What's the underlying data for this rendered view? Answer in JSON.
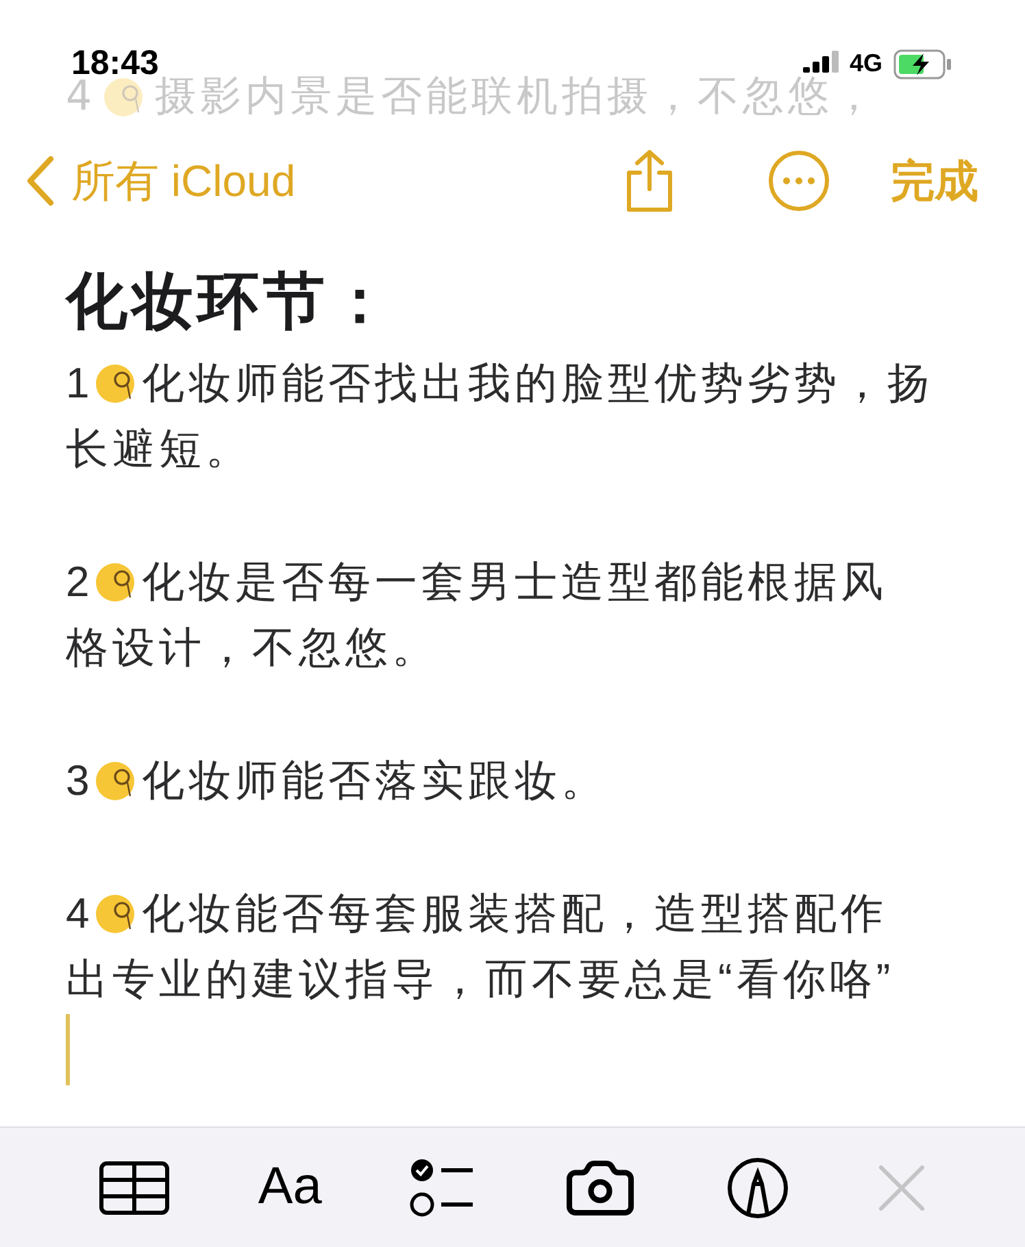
{
  "status_bar": {
    "time": "18:43",
    "network": "4G"
  },
  "scrolled_text": {
    "number": "4",
    "text": "摄影内景是否能联机拍摄，不忽悠，"
  },
  "nav": {
    "back": "所有 iCloud",
    "done": "完成"
  },
  "note": {
    "title": "化妆环节：",
    "items": [
      {
        "number": "1",
        "lines": [
          "化妆师能否找出我的脸型优势劣势，扬",
          "长避短。"
        ]
      },
      {
        "number": "2",
        "lines": [
          "化妆是否每一套男士造型都能根据风",
          "格设计，不忽悠。"
        ]
      },
      {
        "number": "3",
        "lines": [
          "化妆师能否落实跟妆。"
        ]
      },
      {
        "number": "4",
        "lines": [
          "化妆能否每套服装搭配，造型搭配作",
          "出专业的建议指导，而不要总是“看你咯”"
        ]
      }
    ]
  },
  "toolbar": {
    "format": "Aa",
    "close_disabled": true
  }
}
